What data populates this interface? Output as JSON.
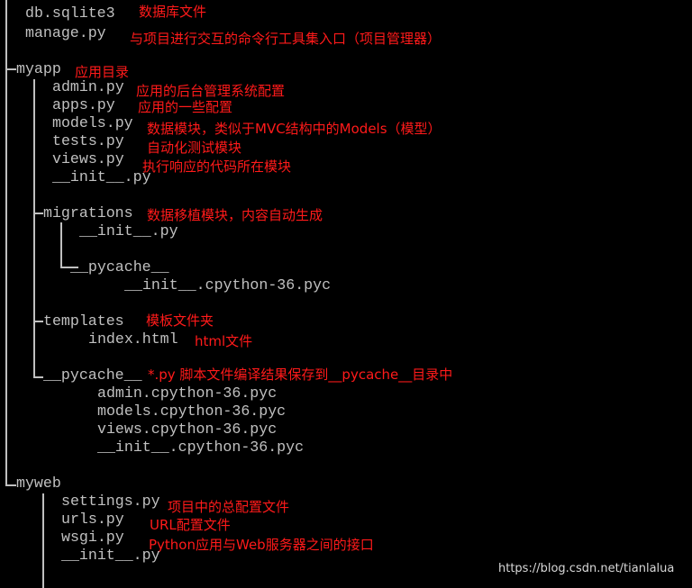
{
  "tree": {
    "root_files": [
      "db.sqlite3",
      "manage.py"
    ],
    "myapp": {
      "name": "myapp",
      "files": [
        "admin.py",
        "apps.py",
        "models.py",
        "tests.py",
        "views.py",
        "__init__.py"
      ],
      "migrations": {
        "name": "migrations",
        "init": "__init__.py",
        "pycache": "__pycache__",
        "pycache_file": "__init__.cpython-36.pyc"
      },
      "templates": {
        "name": "templates",
        "file": "index.html"
      },
      "pycache": {
        "name": "__pycache__",
        "files": [
          "admin.cpython-36.pyc",
          "models.cpython-36.pyc",
          "views.cpython-36.pyc",
          "__init__.cpython-36.pyc"
        ]
      }
    },
    "myweb": {
      "name": "myweb",
      "files": [
        "settings.py",
        "urls.py",
        "wsgi.py",
        "__init__.py"
      ]
    }
  },
  "annotations": {
    "db": "数据库文件",
    "manage": "与项目进行交互的命令行工具集入口（项目管理器）",
    "myapp": "应用目录",
    "admin": "应用的后台管理系统配置",
    "apps": "应用的一些配置",
    "models": "数据模块，类似于MVC结构中的Models（模型）",
    "tests": "自动化测试模块",
    "views": "执行响应的代码所在模块",
    "migrations": "数据移植模块，内容自动生成",
    "templates": "模板文件夹",
    "index": "html文件",
    "pycache": "*.py 脚本文件编译结果保存到__pycache__目录中",
    "settings": "项目中的总配置文件",
    "urls": "URL配置文件",
    "wsgi": "Python应用与Web服务器之间的接口"
  },
  "watermark": "https://blog.csdn.net/tianlalua",
  "colors": {
    "background": "#000000",
    "text": "#c0c0c0",
    "annotation": "#ff1a1a"
  }
}
